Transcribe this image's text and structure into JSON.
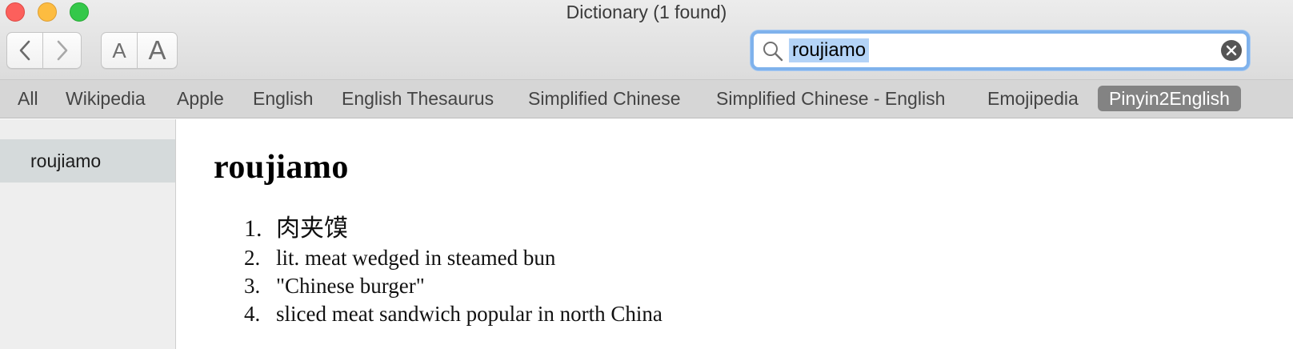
{
  "window": {
    "title": "Dictionary (1 found)"
  },
  "toolbar": {
    "back_icon": "chevron-left-icon",
    "forward_icon": "chevron-right-icon",
    "font_smaller_label": "A",
    "font_larger_label": "A"
  },
  "search": {
    "value": "roujiamo",
    "icon": "search-icon",
    "clear_icon": "clear-icon"
  },
  "tabs": [
    {
      "label": "All"
    },
    {
      "label": "Wikipedia"
    },
    {
      "label": "Apple"
    },
    {
      "label": "English"
    },
    {
      "label": "English Thesaurus"
    },
    {
      "label": "Simplified Chinese"
    },
    {
      "label": "Simplified Chinese - English"
    },
    {
      "label": "Emojipedia"
    },
    {
      "label": "Pinyin2English",
      "active": true
    }
  ],
  "sidebar": {
    "items": [
      {
        "label": "roujiamo",
        "selected": true
      }
    ]
  },
  "entry": {
    "headword": "roujiamo",
    "definitions": [
      {
        "num": "1.",
        "text": "肉夹馍"
      },
      {
        "num": "2.",
        "text": "lit. meat wedged in steamed bun"
      },
      {
        "num": "3.",
        "text": "\"Chinese burger\""
      },
      {
        "num": "4.",
        "text": "sliced meat sandwich popular in north China"
      }
    ]
  },
  "colors": {
    "active_tab": "#838383",
    "search_focus": "#7fb2ec",
    "selection": "#b3d3f7",
    "sidebar_selected": "#d5dadb"
  }
}
